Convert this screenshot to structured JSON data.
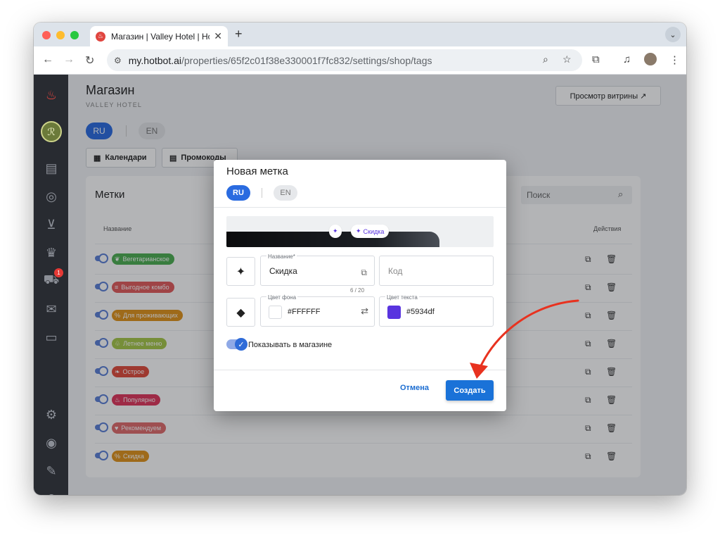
{
  "browser": {
    "tab_title": "Магазин | Valley Hotel | Hotb…",
    "tab_close": "✕",
    "new_tab": "+",
    "url_domain": "my.hotbot.ai",
    "url_path": "/properties/65f2c01f38e330001f7fc832/settings/shop/tags"
  },
  "header": {
    "title": "Магазин",
    "subtitle": "VALLEY HOTEL",
    "storefront_button": "Просмотр витрины ↗"
  },
  "languages": {
    "active": "RU",
    "inactive": "EN"
  },
  "top_tabs": [
    {
      "label": "Календари"
    },
    {
      "label": "Промокоды"
    }
  ],
  "sidebar": {
    "cart_badge": "1"
  },
  "tags_card": {
    "title": "Метки",
    "search_placeholder": "Поиск",
    "col_name": "Название",
    "col_actions": "Действия",
    "rows": [
      {
        "label": "Вегетарианское",
        "color": "#4caf50",
        "icon": "❦"
      },
      {
        "label": "Выгодное комбо",
        "color": "#e25b5b",
        "icon": "≡"
      },
      {
        "label": "Для проживающих",
        "color": "#e0921a",
        "icon": "%"
      },
      {
        "label": "Летнее меню",
        "color": "#a6c847",
        "icon": "♧"
      },
      {
        "label": "Острое",
        "color": "#e04a3a",
        "icon": "❧"
      },
      {
        "label": "Популярно",
        "color": "#e0345a",
        "icon": "♨"
      },
      {
        "label": "Рекомендуем",
        "color": "#e06a6a",
        "icon": "♥"
      },
      {
        "label": "Скидка",
        "color": "#e0921a",
        "icon": "%"
      }
    ]
  },
  "modal": {
    "title": "Новая метка",
    "lang_active": "RU",
    "lang_inactive": "EN",
    "preview_tag": "Скидка",
    "name_label": "Название*",
    "name_value": "Скидка",
    "name_counter": "6 / 20",
    "code_placeholder": "Код",
    "bg_label": "Цвет фона",
    "bg_value": "#FFFFFF",
    "text_label": "Цвет текста",
    "text_value": "#5934df",
    "show_in_shop": "Показывать в магазине",
    "cancel": "Отмена",
    "create": "Создать",
    "accent": "#1a72d8"
  }
}
